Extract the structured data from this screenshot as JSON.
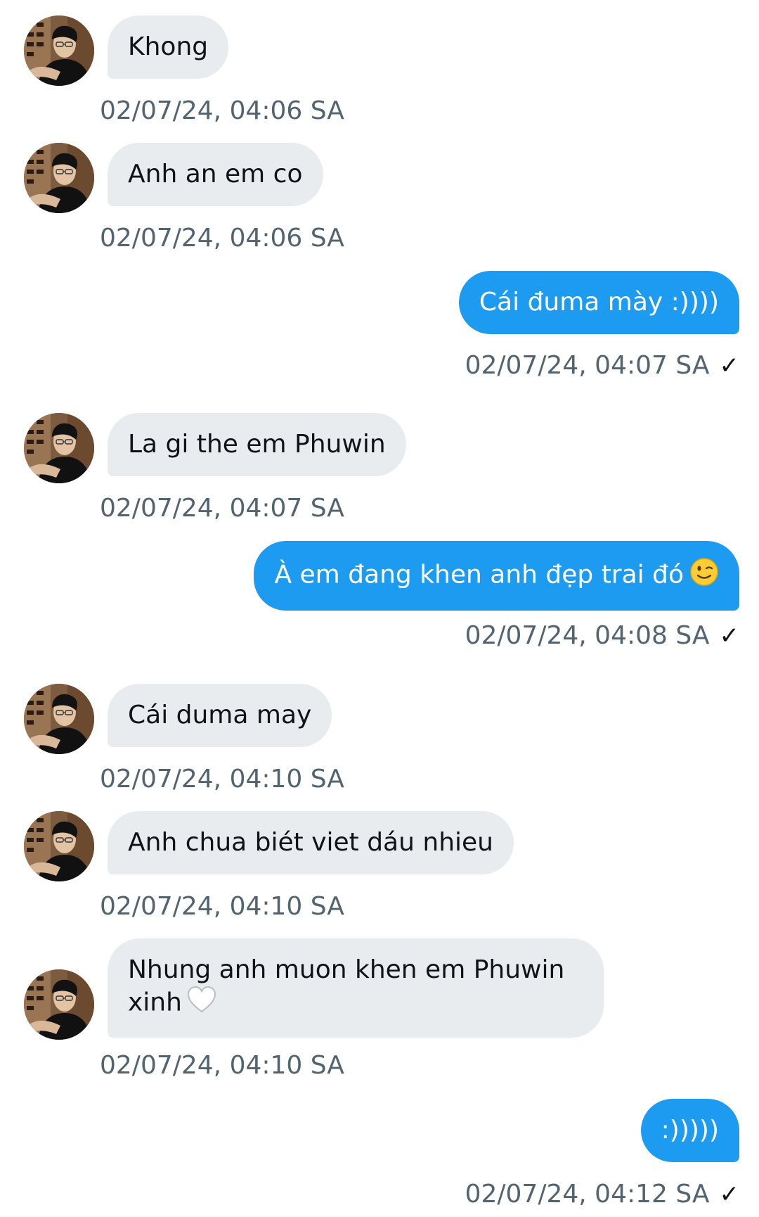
{
  "messages": [
    {
      "text": "Khong",
      "time": "02/07/24, 04:06 SA"
    },
    {
      "text": "Anh an em co",
      "time": "02/07/24, 04:06 SA"
    },
    {
      "text": "Cái đuma mày :))))",
      "time": "02/07/24, 04:07 SA",
      "status_icon": "check-icon"
    },
    {
      "text": "La gi the em Phuwin",
      "time": "02/07/24, 04:07 SA"
    },
    {
      "text": "À em đang khen anh đẹp trai đó",
      "emoji": "winking-face-icon",
      "time": "02/07/24, 04:08 SA",
      "status_icon": "check-icon"
    },
    {
      "text": "Cái duma may",
      "time": "02/07/24, 04:10 SA"
    },
    {
      "text": "Anh chua biét viet dáu nhieu",
      "time": "02/07/24, 04:10 SA"
    },
    {
      "text": "Nhung anh muon khen em Phuwin xinh",
      "emoji": "white-heart-icon",
      "time": "02/07/24, 04:10 SA"
    },
    {
      "text": ":)))))",
      "time": "02/07/24, 04:12 SA",
      "status_icon": "check-icon"
    }
  ],
  "check_glyph": "✓",
  "colors": {
    "incoming_bubble": "#e8ecef",
    "outgoing_bubble": "#1d9bf0",
    "timestamp": "#536471",
    "text": "#0f1419"
  }
}
